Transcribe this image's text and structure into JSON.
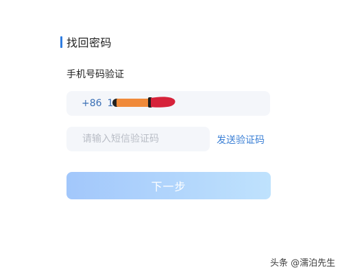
{
  "form": {
    "title": "找回密码",
    "section_label": "手机号码验证",
    "phone": {
      "prefix": "+86",
      "visible_digits": "1"
    },
    "code_input": {
      "placeholder": "请输入短信验证码",
      "value": ""
    },
    "send_code_label": "发送验证码",
    "next_label": "下一步"
  },
  "watermark": {
    "text": "头条 @濡泊先生"
  },
  "colors": {
    "accent": "#2f7de1",
    "link": "#3a7fd5",
    "field_bg": "#f4f6fa",
    "button_gradient_start": "#a2c7fb",
    "button_gradient_end": "#bfe2fd"
  }
}
